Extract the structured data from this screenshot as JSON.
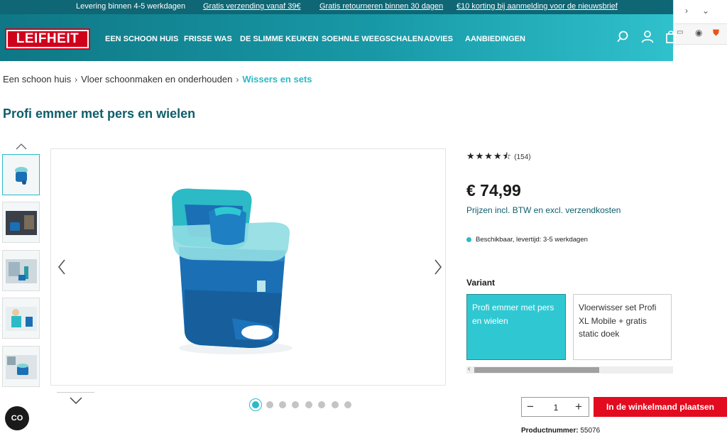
{
  "topbar": {
    "delivery": "Levering binnen 4-5 werkdagen",
    "free_shipping": "Gratis verzending vanaf 39€",
    "free_returns": "Gratis retourneren binnen 30 dagen",
    "newsletter": "€10 korting bij aanmelding voor de nieuwsbrief"
  },
  "header": {
    "logo_text": "LEIFHEIT",
    "nav": [
      "EEN SCHOON HUIS",
      "FRISSE WAS",
      "DE SLIMME KEUKEN",
      "SOEHNLE WEEGSCHALEN",
      "ADVIES",
      "AANBIEDINGEN"
    ],
    "icons": [
      "search-icon",
      "account-icon",
      "cart-icon"
    ]
  },
  "breadcrumb": {
    "items": [
      "Een schoon huis",
      "Vloer schoonmaken en onderhouden"
    ],
    "current": "Wissers en sets",
    "separator": "›"
  },
  "product": {
    "title": "Profi emmer met pers en wielen",
    "rating_stars": "★★★★⯪",
    "rating_value": 4.5,
    "rating_count": "(154)",
    "price": "€ 74,99",
    "price_note": "Prijzen incl. BTW en excl. verzendkosten",
    "availability": "Beschikbaar, levertijd: 3-5 werkdagen",
    "variant_label": "Variant",
    "variants": [
      {
        "label": "Profi emmer met pers en wielen",
        "selected": true
      },
      {
        "label": "Vloerwisser set Profi XL Mobile + gratis static doek",
        "selected": false
      }
    ],
    "quantity": "1",
    "add_to_cart": "In de winkelmand plaatsen",
    "sku_label": "Productnummer:",
    "sku_value": "55076"
  },
  "gallery": {
    "thumb_count": 5,
    "dot_count": 8,
    "active_dot": 0
  },
  "chat": {
    "label": "CO"
  },
  "colors": {
    "brand_red": "#e30b1f",
    "teal_dark": "#0f6674",
    "teal_accent": "#2bbac6",
    "bucket_blue": "#1a6fb5"
  }
}
